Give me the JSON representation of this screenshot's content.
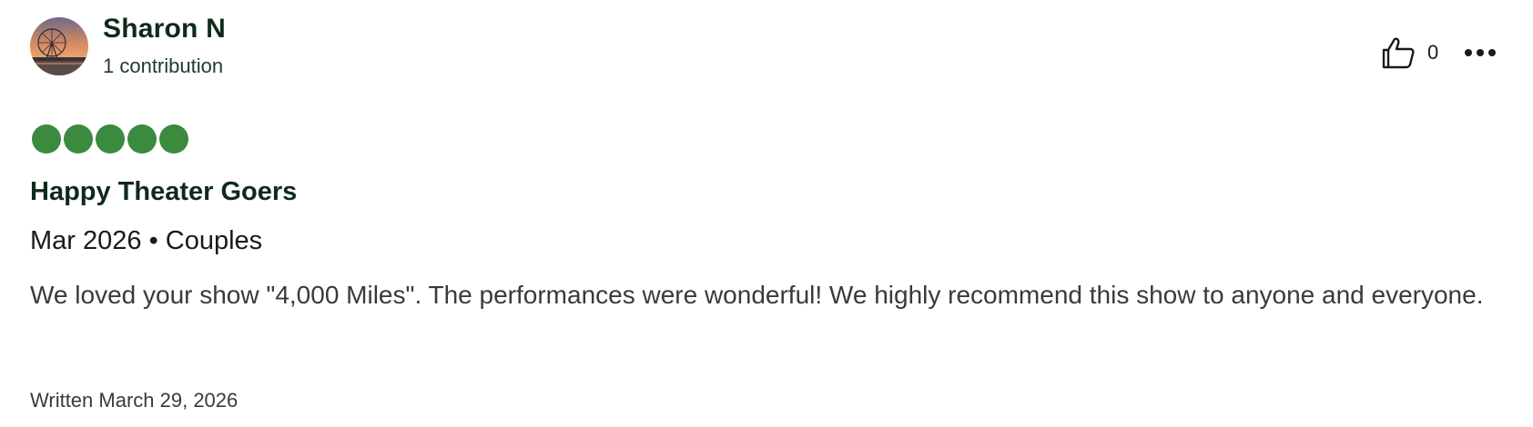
{
  "review": {
    "user": {
      "name": "Sharon N",
      "contributions": "1 contribution",
      "avatar_icon": "avatar-ferris-wheel-sunset"
    },
    "helpful": {
      "icon": "thumbs-up-icon",
      "count": "0"
    },
    "more_icon": "ellipsis-icon",
    "rating": {
      "value": 5,
      "max": 5,
      "color": "#3b8a3e"
    },
    "title": "Happy Theater Goers",
    "meta": "Mar 2026 • Couples",
    "body": "We loved your show \"4,000 Miles\". The performances were wonderful! We highly recommend this show to anyone and everyone.",
    "written": "Written March 29, 2026"
  }
}
